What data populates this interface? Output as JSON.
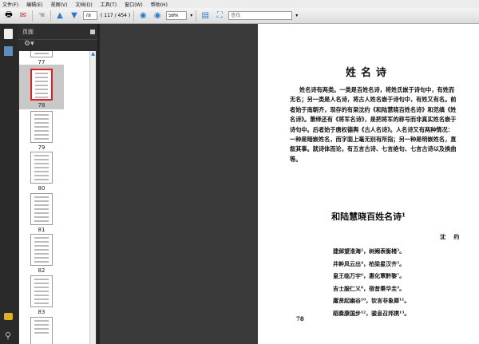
{
  "menu": [
    "文件(F)",
    "编辑(E)",
    "视图(V)",
    "文档(D)",
    "工具(T)",
    "窗口(W)",
    "帮助(H)"
  ],
  "toolbar": {
    "page_value": "78",
    "page_count": "( 117 / 454 )",
    "zoom": "58%",
    "search_placeholder": "查找"
  },
  "panel": {
    "title": "页面",
    "thumbnails": [
      {
        "label": "77",
        "selected": false
      },
      {
        "label": "78",
        "selected": true
      },
      {
        "label": "79",
        "selected": false
      },
      {
        "label": "80",
        "selected": false
      },
      {
        "label": "81",
        "selected": false
      },
      {
        "label": "82",
        "selected": false
      },
      {
        "label": "83",
        "selected": false
      }
    ]
  },
  "page": {
    "title": "姓名诗",
    "paragraph": "姓名诗有两类。一类是百姓名诗，将姓氏嵌于诗句中，有姓而无名；另一类是人名诗，将古人姓名嵌于诗句中，有姓又有名。前者始于南朝齐，现存的有梁沈约《和陆慧晓百姓名诗》和范缜《姓名诗》。萧绎还有《将军名诗》，是把将军的称号而非真实姓名嵌于诗句中。后者始于唐权德舆《古人名诗》。人名诗又有两种情况：一种是暗嵌姓名，而字面上毫无别有所指；另一种是明嵌姓名，直叙其事。就诗体而论，有五言古诗、七言绝句、七言古诗以及换曲等。",
    "poem_title": "和陆慧晓百姓名诗¹",
    "author": "沈 约",
    "lines": [
      "建邺望淮海²，树阙表衡楮³。",
      "井幹风云出⁴，柏梁星汉齐⁵。",
      "皇王临万宇⁶，惠化覃黔黎⁷。",
      "吉士服仁义⁸，宿昔秉华圭⁹。",
      "庸贤起幽谷¹⁰，钦言非象犀¹¹。",
      "蹈奏康国步¹²，骏息召邦携¹³。"
    ],
    "page_number": "78"
  }
}
